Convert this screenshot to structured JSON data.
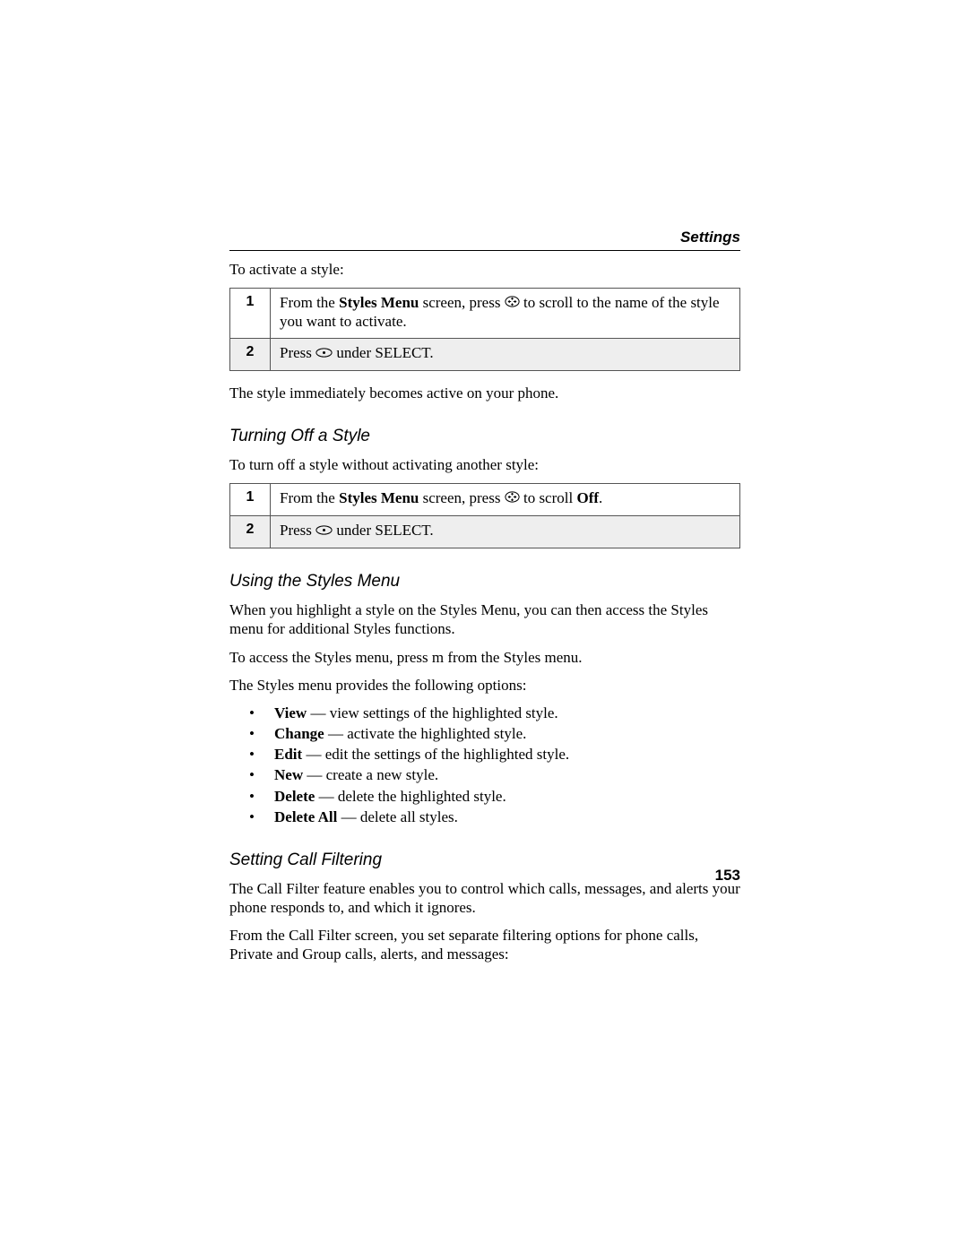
{
  "header": {
    "section": "Settings"
  },
  "intro": {
    "text": "To activate a style:"
  },
  "steps_activate": [
    {
      "num": "1",
      "pre": "From the ",
      "bold1": "Styles Menu",
      "mid": " screen, press ",
      "icon": "nav",
      "post": " to scroll to the name of the style you want to activate."
    },
    {
      "num": "2",
      "pre": "Press ",
      "icon": "dot",
      "post": " under SELECT."
    }
  ],
  "after_activate": "The style immediately becomes active on your phone.",
  "h_turnoff": "Turning Off a Style",
  "turnoff_intro": "To turn off a style without activating another style:",
  "steps_turnoff": [
    {
      "num": "1",
      "pre": "From the ",
      "bold1": "Styles Menu",
      "mid": " screen, press ",
      "icon": "nav",
      "post1": " to scroll ",
      "bold2": "Off",
      "post2": "."
    },
    {
      "num": "2",
      "pre": "Press ",
      "icon": "dot",
      "post": " under SELECT."
    }
  ],
  "h_using": "Using the Styles Menu",
  "using_p1": "When you highlight a style on the Styles Menu, you can then access the Styles menu for additional Styles functions.",
  "using_p2": "To access the Styles menu, press m from the Styles menu.",
  "using_p3": "The Styles menu provides the following options:",
  "options": [
    {
      "bold": "View",
      "rest": " — view settings of the highlighted style."
    },
    {
      "bold": "Change",
      "rest": " — activate the highlighted style."
    },
    {
      "bold": "Edit",
      "rest": " — edit the settings of the highlighted style."
    },
    {
      "bold": "New",
      "rest": " — create a new style."
    },
    {
      "bold": "Delete",
      "rest": " — delete the highlighted style."
    },
    {
      "bold": "Delete All",
      "rest": " — delete all styles."
    }
  ],
  "h_cf": "Setting Call Filtering",
  "cf_p1": "The Call Filter feature enables you to control which calls, messages, and alerts your phone responds to, and which it ignores.",
  "cf_p2": "From the Call Filter screen, you set separate filtering options for phone calls, Private and Group calls, alerts, and messages:",
  "page_number": "153"
}
